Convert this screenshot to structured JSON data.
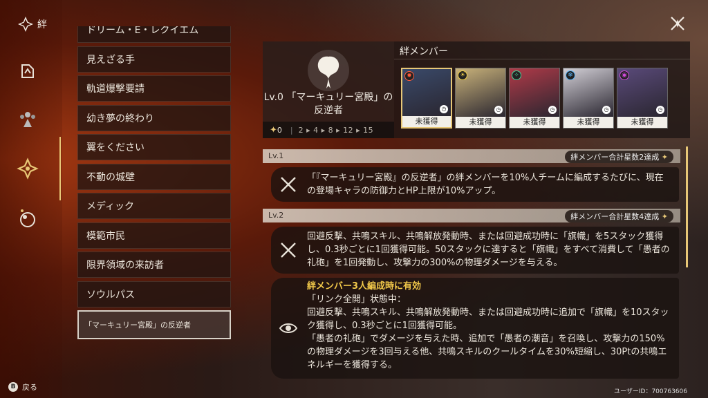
{
  "rail": {
    "title": "絆",
    "items": [
      {
        "name": "export-icon"
      },
      {
        "name": "team-icon"
      },
      {
        "name": "bond-icon",
        "active": true
      },
      {
        "name": "orb-icon"
      }
    ],
    "back_key": "B",
    "back_label": "戻る"
  },
  "list": {
    "items": [
      "ドリーム・E・レクイエム",
      "見えざる手",
      "軌道爆撃要請",
      "幼き夢の終わり",
      "翼をください",
      "不動の城壁",
      "メディック",
      "模範市民",
      "限界領域の来訪者",
      "ソウルパス"
    ],
    "selected": "「マーキュリー宮殿」の反逆者"
  },
  "hero": {
    "title": "Lv.0 「マーキュリー宮殿」の反逆者",
    "stars": "0",
    "progress": "2 ▸ 4 ▸ 8 ▸ 12 ▸ 15"
  },
  "members": {
    "title": "絆メンバー",
    "cards": [
      {
        "status": "未獲得",
        "element": "fire",
        "element_color": "#ff5a3a",
        "art_color": "#3a4a6a"
      },
      {
        "status": "未獲得",
        "element": "light",
        "element_color": "#f5d24a",
        "art_color": "#c9b27a"
      },
      {
        "status": "未獲得",
        "element": "wind",
        "element_color": "#4ad49a",
        "art_color": "#b03a48"
      },
      {
        "status": "未獲得",
        "element": "ice",
        "element_color": "#5ab8ff",
        "art_color": "#d2cfd6"
      },
      {
        "status": "未獲得",
        "element": "dark",
        "element_color": "#d04ad8",
        "art_color": "#5a4a7a"
      }
    ]
  },
  "levels": [
    {
      "lv": "Lv.1",
      "condition": "絆メンバー合計星数2達成",
      "text": "「『マーキュリー宮殿』の反逆者」の絆メンバーを10%人チームに編成するたびに、現在の登場キャラの防御力とHP上限が10%アップ。"
    },
    {
      "lv": "Lv.2",
      "condition": "絆メンバー合計星数4達成",
      "text": "回避反撃、共鳴スキル、共鳴解放発動時、または回避成功時に「旗幟」を5スタック獲得し、0.3秒ごとに1回獲得可能。50スタックに達すると「旗幟」をすべて消費して「愚者の礼砲」を1回発動し、攻撃力の300%の物理ダメージを与える。"
    }
  ],
  "bonus": {
    "highlight": "絆メンバー3人編成時に有効",
    "line1": "「リンク全開」状態中：",
    "line2": "回避反撃、共鳴スキル、共鳴解放発動時、または回避成功時に追加で「旗幟」を10スタック獲得し、0.3秒ごとに1回獲得可能。",
    "line3": "「愚者の礼砲」でダメージを与えた時、追加で「愚者の潮音」を召喚し、攻撃力の150%の物理ダメージを3回与える他、共鳴スキルのクールタイムを30%短縮し、30Ptの共鳴エネルギーを獲得する。"
  },
  "user_id": "ユーザーID：700763606",
  "colors": {
    "accent": "#e7c777",
    "highlight": "#f1c84a"
  }
}
